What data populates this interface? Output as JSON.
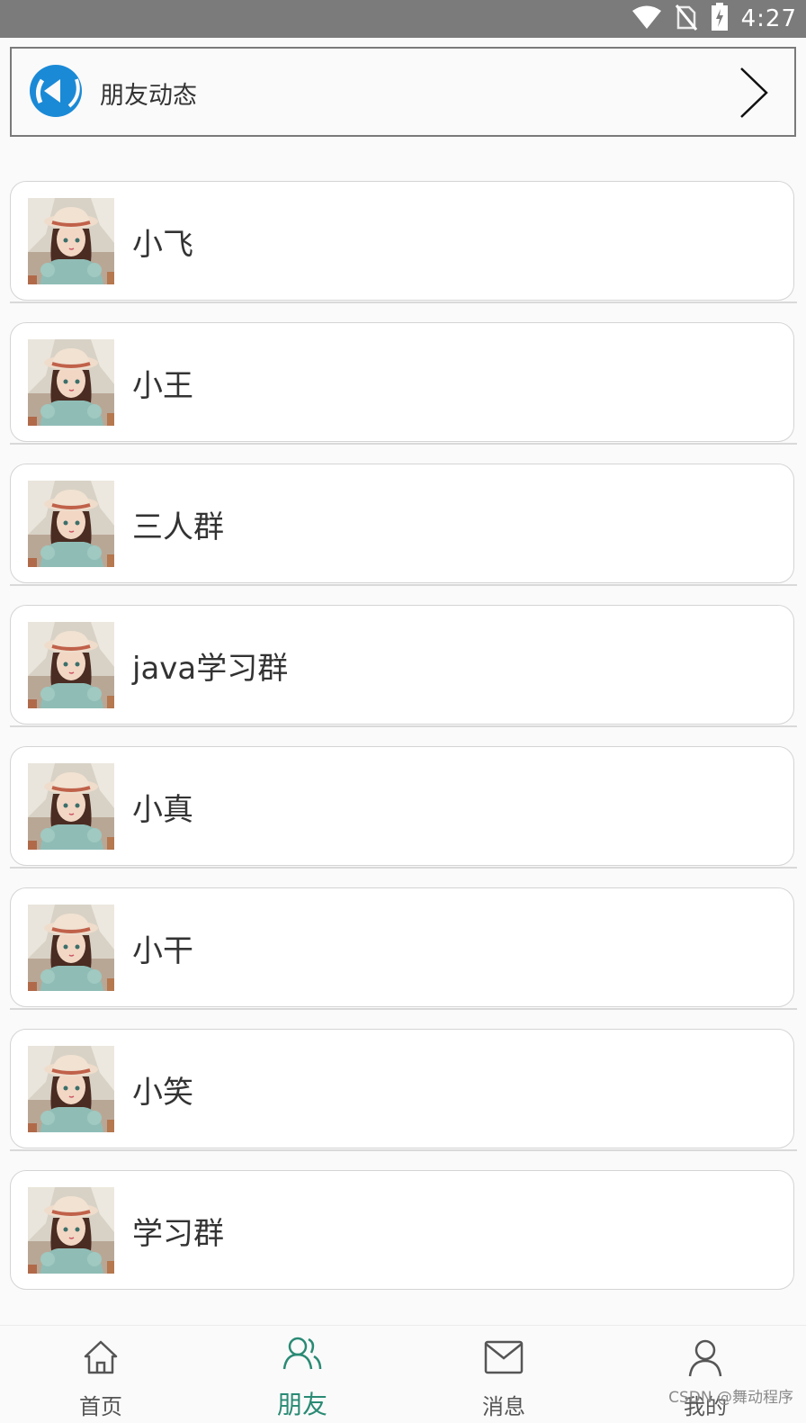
{
  "status_bar": {
    "time": "4:27",
    "icons": [
      "wifi-icon",
      "no-sim-icon",
      "battery-charging-icon"
    ]
  },
  "moments": {
    "label": "朋友动态",
    "icon": "logo-icon",
    "chevron": "chevron-right-icon"
  },
  "contacts": [
    {
      "name": "小飞"
    },
    {
      "name": "小王"
    },
    {
      "name": "三人群"
    },
    {
      "name": "java学习群"
    },
    {
      "name": "小真"
    },
    {
      "name": "小干"
    },
    {
      "name": "小笑"
    },
    {
      "name": "学习群"
    }
  ],
  "tabbar": {
    "tabs": [
      {
        "label": "首页",
        "icon": "home-icon"
      },
      {
        "label": "朋友",
        "icon": "friends-icon",
        "active": true
      },
      {
        "label": "消息",
        "icon": "mail-icon"
      },
      {
        "label": "我的",
        "icon": "user-icon"
      }
    ]
  },
  "watermark": "CSDN @舞动程序",
  "colors": {
    "accent": "#2a8a74",
    "status_bar": "#7b7b7b",
    "logo_blue": "#1a8ad6"
  }
}
